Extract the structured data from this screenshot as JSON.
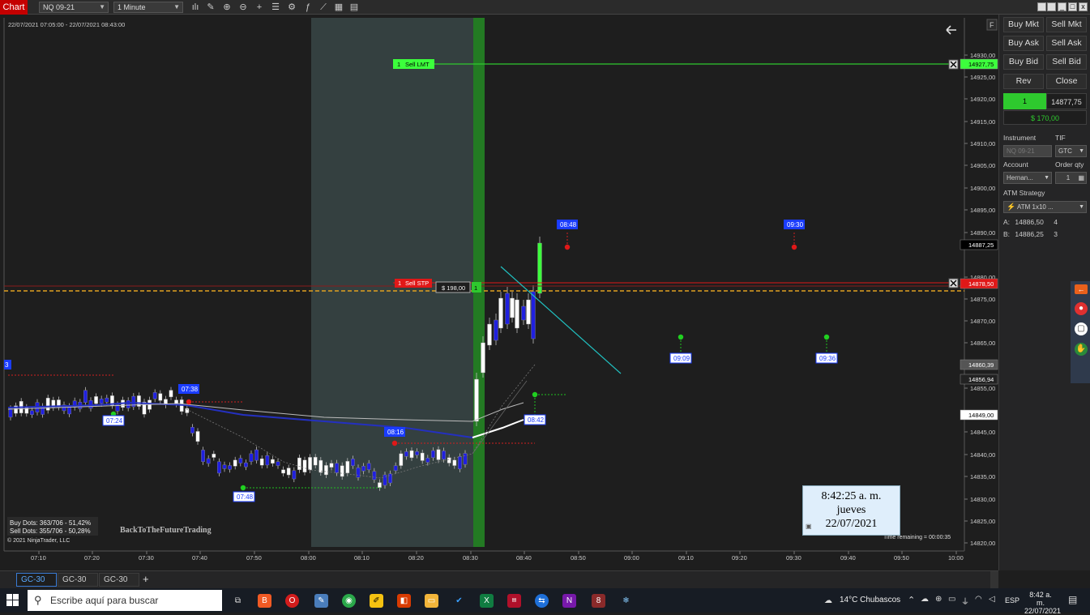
{
  "toolbar": {
    "chart_tab": "Chart",
    "instrument": "NQ 09-21",
    "interval": "1 Minute",
    "tools": [
      "bars-icon",
      "pencil-icon",
      "zoom-in-icon",
      "zoom-out-icon",
      "crosshair-icon",
      "properties-icon",
      "strategy-icon",
      "indicator-icon",
      "snapshot-icon",
      "datagrid-icon"
    ],
    "window_buttons": [
      "_",
      "□",
      "x"
    ]
  },
  "chart": {
    "range_label": "22/07/2021 07:05:00 - 22/07/2021 08:43:00",
    "y_labels": [
      "14930,00",
      "14925,00",
      "14920,00",
      "14915,00",
      "14910,00",
      "14905,00",
      "14900,00",
      "14895,00",
      "14890,00",
      "14880,00",
      "14875,00",
      "14870,00",
      "14865,00",
      "14855,00",
      "14845,00",
      "14840,00",
      "14835,00",
      "14830,00",
      "14825,00",
      "14820,00"
    ],
    "x_labels": [
      "07:10",
      "07:20",
      "07:30",
      "07:40",
      "07:50",
      "08:00",
      "08:10",
      "08:20",
      "08:30",
      "08:40",
      "08:50",
      "09:00",
      "09:10",
      "09:20",
      "09:30",
      "09:40",
      "09:50",
      "10:00"
    ],
    "price_tags": [
      {
        "label": "14927,75",
        "color": "#3cff3c",
        "text": "#000"
      },
      {
        "label": "14887,25",
        "color": "#000",
        "text": "#fff"
      },
      {
        "label": "14878,50",
        "color": "#e01818",
        "text": "#fff"
      },
      {
        "label": "14860,39",
        "color": "#555",
        "text": "#fff"
      },
      {
        "label": "14856,94",
        "color": "#222",
        "text": "#fff"
      },
      {
        "label": "14849,00",
        "color": "#fff",
        "text": "#000"
      }
    ],
    "sell_lmt": {
      "qty": "1",
      "label": "Sell LMT"
    },
    "sell_stp": {
      "qty": "1",
      "label": "Sell STP"
    },
    "pnl_tag": "$ 198,00",
    "pnl_qty": "1",
    "time_labels": [
      "07:38",
      "07:24",
      "07:48",
      "08:16",
      "08:42",
      "08:48",
      "09:30",
      "09:09",
      "09:36"
    ],
    "edge_label": "3",
    "dots_stats": [
      "Buy Dots: 363/706 - 51,42%",
      "Sell Dots: 355/706 - 50,28%"
    ],
    "copyright": "© 2021 NinjaTrader, LLC",
    "watermark": "BackToTheFutureTrading",
    "time_remaining": "Time remaining = 00:00:35",
    "f_label": "F"
  },
  "clock": {
    "time": "8:42:25 a. m.",
    "day": "jueves",
    "date": "22/07/2021"
  },
  "order_panel": {
    "buttons": [
      "Buy Mkt",
      "Sell Mkt",
      "Buy Ask",
      "Sell Ask",
      "Buy Bid",
      "Sell Bid",
      "Rev",
      "Close"
    ],
    "position_qty": "1",
    "position_price": "14877,75",
    "pnl": "$ 170,00",
    "instrument_label": "Instrument",
    "tif_label": "TIF",
    "instrument_value": "NQ 09-21",
    "tif_value": "GTC",
    "account_label": "Account",
    "orderqty_label": "Order qty",
    "account_value": "Hernan...",
    "orderqty_value": "1",
    "atm_label": "ATM Strategy",
    "atm_value": "ATM 1x10 ...",
    "a_row": {
      "label": "A:",
      "price": "14886,50",
      "qty": "4"
    },
    "b_row": {
      "label": "B:",
      "price": "14886,25",
      "qty": "3"
    }
  },
  "tabs": [
    "GC-30",
    "GC-30",
    "GC-30"
  ],
  "tab_add": "+",
  "taskbar": {
    "search_placeholder": "Escribe aquí para buscar",
    "weather": "14°C  Chubascos",
    "lang": "ESP",
    "time": "8:42 a. m.",
    "date": "22/07/2021",
    "notif_count": "8"
  }
}
